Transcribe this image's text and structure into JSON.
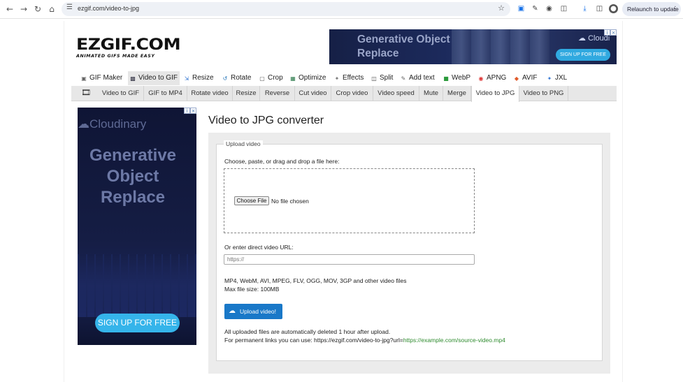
{
  "browser": {
    "url": "ezgif.com/video-to-jpg",
    "relaunch_label": "Relaunch to update",
    "icons": [
      "back-icon",
      "forward-icon",
      "reload-icon",
      "home-icon",
      "site-info-icon",
      "bookmark-star-icon",
      "extension-icon",
      "pen-icon",
      "camera-icon",
      "puzzle-icon",
      "download-icon",
      "sidebar-icon",
      "profile-avatar",
      "menu-dots-icon"
    ]
  },
  "logo": {
    "main": "EZGIF.COM",
    "tagline": "ANIMATED GIFS MADE EASY"
  },
  "top_ad": {
    "headline_1": "Generative Object",
    "headline_2": "Replace",
    "brand": "Cloudi",
    "cta": "SIGN UP FOR FREE"
  },
  "main_nav": [
    {
      "label": "GIF Maker",
      "icon": "gif-maker-icon",
      "active": false
    },
    {
      "label": "Video to GIF",
      "icon": "video-icon",
      "active": true
    },
    {
      "label": "Resize",
      "icon": "resize-icon",
      "active": false
    },
    {
      "label": "Rotate",
      "icon": "rotate-icon",
      "active": false
    },
    {
      "label": "Crop",
      "icon": "crop-icon",
      "active": false
    },
    {
      "label": "Optimize",
      "icon": "optimize-icon",
      "active": false
    },
    {
      "label": "Effects",
      "icon": "effects-icon",
      "active": false
    },
    {
      "label": "Split",
      "icon": "split-icon",
      "active": false
    },
    {
      "label": "Add text",
      "icon": "add-text-icon",
      "active": false
    },
    {
      "label": "WebP",
      "icon": "webp-icon",
      "active": false
    },
    {
      "label": "APNG",
      "icon": "apng-icon",
      "active": false
    },
    {
      "label": "AVIF",
      "icon": "avif-icon",
      "active": false
    },
    {
      "label": "JXL",
      "icon": "jxl-icon",
      "active": false
    }
  ],
  "sub_nav": [
    {
      "label": "Video to GIF",
      "active": false
    },
    {
      "label": "GIF to MP4",
      "active": false
    },
    {
      "label": "Rotate video",
      "active": false
    },
    {
      "label": "Resize",
      "active": false
    },
    {
      "label": "Reverse",
      "active": false
    },
    {
      "label": "Cut video",
      "active": false
    },
    {
      "label": "Crop video",
      "active": false
    },
    {
      "label": "Video speed",
      "active": false
    },
    {
      "label": "Mute",
      "active": false
    },
    {
      "label": "Merge",
      "active": false
    },
    {
      "label": "Video to JPG",
      "active": true
    },
    {
      "label": "Video to PNG",
      "active": false
    }
  ],
  "left_ad": {
    "brand": "Cloudinary",
    "headline_1": "Generative",
    "headline_2": "Object",
    "headline_3": "Replace",
    "cta": "SIGN UP FOR FREE"
  },
  "content": {
    "title": "Video to JPG converter",
    "legend": "Upload video",
    "choose_label": "Choose, paste, or drag and drop a file here:",
    "choose_button": "Choose File",
    "no_file": "No file chosen",
    "url_label": "Or enter direct video URL:",
    "url_placeholder": "https://",
    "formats": "MP4, WebM, AVI, MPEG, FLV, OGG, MOV, 3GP and other video files",
    "max_size": "Max file size: 100MB",
    "upload_button": "Upload video!",
    "deleted_note": "All uploaded files are automatically deleted 1 hour after upload.",
    "permalink_prefix": "For permanent links you can use: https://ezgif.com/video-to-jpg?url=",
    "permalink_example": "https://example.com/source-video.mp4"
  }
}
